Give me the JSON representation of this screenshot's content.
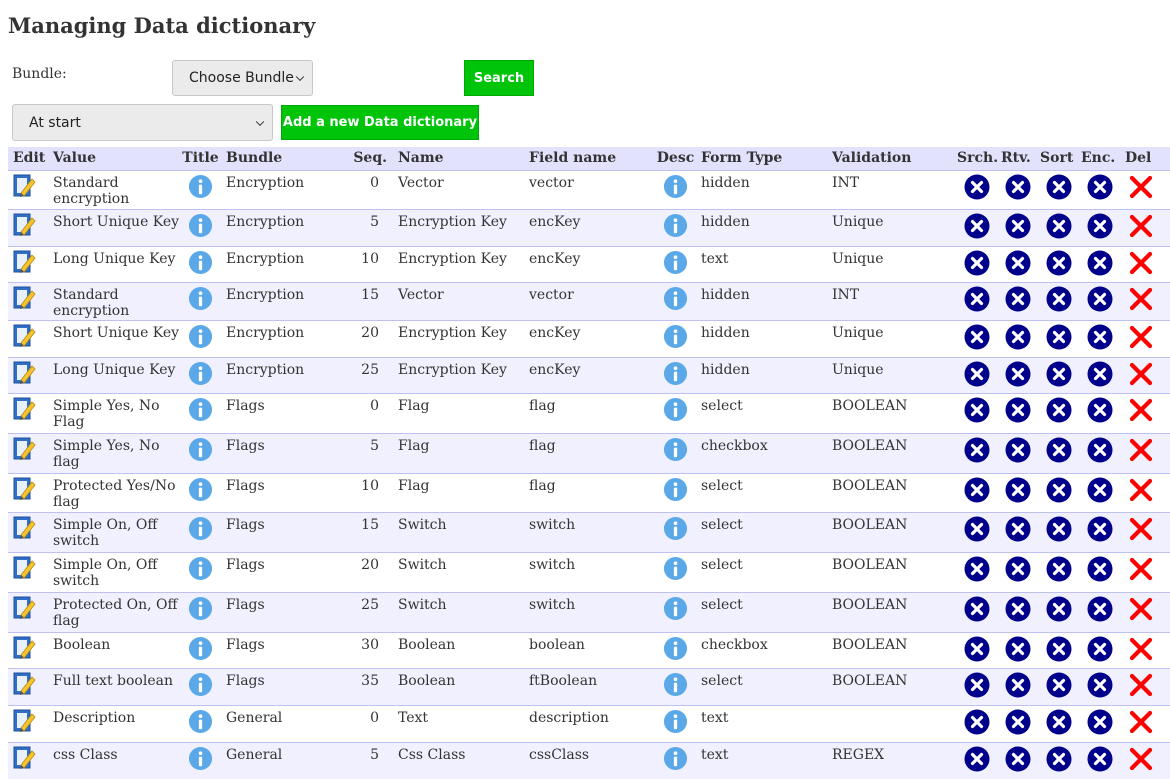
{
  "page": {
    "title": "Managing Data dictionary"
  },
  "filter": {
    "bundle_label": "Bundle:",
    "bundle_select": "Choose Bundle",
    "search_button": "Search",
    "position_select": "At start",
    "add_button": "Add a new Data dictionary"
  },
  "colors": {
    "button_green": "#00c40a",
    "header_bg": "#e2e2fd",
    "row_alt_bg": "#f0f0fe",
    "action_blue": "#00008b",
    "delete_red": "#ff0000",
    "info_blue": "#5aa8e8"
  },
  "icons": {
    "edit": "edit-pencil-icon",
    "info": "info-icon",
    "flag_off": "cross-circle-icon",
    "delete": "red-x-icon"
  },
  "table": {
    "headers": {
      "edit": "Edit",
      "value": "Value",
      "title": "Title",
      "bundle": "Bundle",
      "seq": "Seq.",
      "name": "Name",
      "field": "Field name",
      "desc": "Desc",
      "form": "Form Type",
      "validation": "Validation",
      "srch": "Srch.",
      "rtv": "Rtv.",
      "sort": "Sort",
      "enc": "Enc.",
      "del": "Del"
    },
    "rows": [
      {
        "value": "Standard encryption",
        "bundle": "Encryption",
        "seq": "0",
        "name": "Vector",
        "field": "vector",
        "form": "hidden",
        "validation": "INT"
      },
      {
        "value": "Short Unique Key",
        "bundle": "Encryption",
        "seq": "5",
        "name": "Encryption Key",
        "field": "encKey",
        "form": "hidden",
        "validation": "Unique"
      },
      {
        "value": "Long Unique Key",
        "bundle": "Encryption",
        "seq": "10",
        "name": "Encryption Key",
        "field": "encKey",
        "form": "text",
        "validation": "Unique"
      },
      {
        "value": "Standard encryption",
        "bundle": "Encryption",
        "seq": "15",
        "name": "Vector",
        "field": "vector",
        "form": "hidden",
        "validation": "INT"
      },
      {
        "value": "Short Unique Key",
        "bundle": "Encryption",
        "seq": "20",
        "name": "Encryption Key",
        "field": "encKey",
        "form": "hidden",
        "validation": "Unique"
      },
      {
        "value": "Long Unique Key",
        "bundle": "Encryption",
        "seq": "25",
        "name": "Encryption Key",
        "field": "encKey",
        "form": "hidden",
        "validation": "Unique"
      },
      {
        "value": "Simple Yes, No Flag",
        "bundle": "Flags",
        "seq": "0",
        "name": "Flag",
        "field": "flag",
        "form": "select",
        "validation": "BOOLEAN"
      },
      {
        "value": "Simple Yes, No flag",
        "bundle": "Flags",
        "seq": "5",
        "name": "Flag",
        "field": "flag",
        "form": "checkbox",
        "validation": "BOOLEAN"
      },
      {
        "value": "Protected Yes/No flag",
        "bundle": "Flags",
        "seq": "10",
        "name": "Flag",
        "field": "flag",
        "form": "select",
        "validation": "BOOLEAN"
      },
      {
        "value": "Simple On, Off switch",
        "bundle": "Flags",
        "seq": "15",
        "name": "Switch",
        "field": "switch",
        "form": "select",
        "validation": "BOOLEAN"
      },
      {
        "value": "Simple On, Off switch",
        "bundle": "Flags",
        "seq": "20",
        "name": "Switch",
        "field": "switch",
        "form": "select",
        "validation": "BOOLEAN"
      },
      {
        "value": "Protected On, Off flag",
        "bundle": "Flags",
        "seq": "25",
        "name": "Switch",
        "field": "switch",
        "form": "select",
        "validation": "BOOLEAN"
      },
      {
        "value": "Boolean",
        "bundle": "Flags",
        "seq": "30",
        "name": "Boolean",
        "field": "boolean",
        "form": "checkbox",
        "validation": "BOOLEAN"
      },
      {
        "value": "Full text boolean",
        "bundle": "Flags",
        "seq": "35",
        "name": "Boolean",
        "field": "ftBoolean",
        "form": "select",
        "validation": "BOOLEAN"
      },
      {
        "value": "Description",
        "bundle": "General",
        "seq": "0",
        "name": "Text",
        "field": "description",
        "form": "text",
        "validation": ""
      },
      {
        "value": "css Class",
        "bundle": "General",
        "seq": "5",
        "name": "Css Class",
        "field": "cssClass",
        "form": "text",
        "validation": "REGEX"
      }
    ]
  }
}
